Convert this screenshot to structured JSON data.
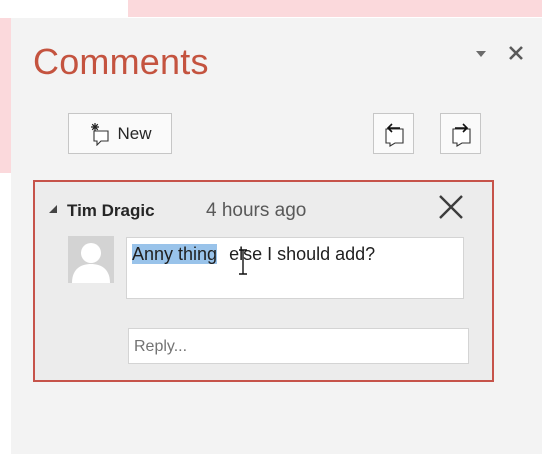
{
  "pane": {
    "title": "Comments",
    "new_label": "New"
  },
  "comment": {
    "author": "Tim Dragic",
    "time": "4 hours ago",
    "text_selected": "Anny thing",
    "text_rest": "else I should add?",
    "reply_placeholder": "Reply..."
  },
  "colors": {
    "accent": "#c6534a",
    "title": "#c4533f",
    "selection": "#99c3ea",
    "slide_background": "#fbd9dc"
  },
  "icons": {
    "pane_options": "triangle-down-icon",
    "pane_close": "close-icon",
    "new_comment": "new-comment-icon",
    "previous": "previous-comment-icon",
    "next": "next-comment-icon",
    "delete": "delete-x-icon",
    "collapse": "collapse-triangle-icon",
    "avatar": "user-avatar-icon",
    "cursor": "text-cursor-icon"
  }
}
